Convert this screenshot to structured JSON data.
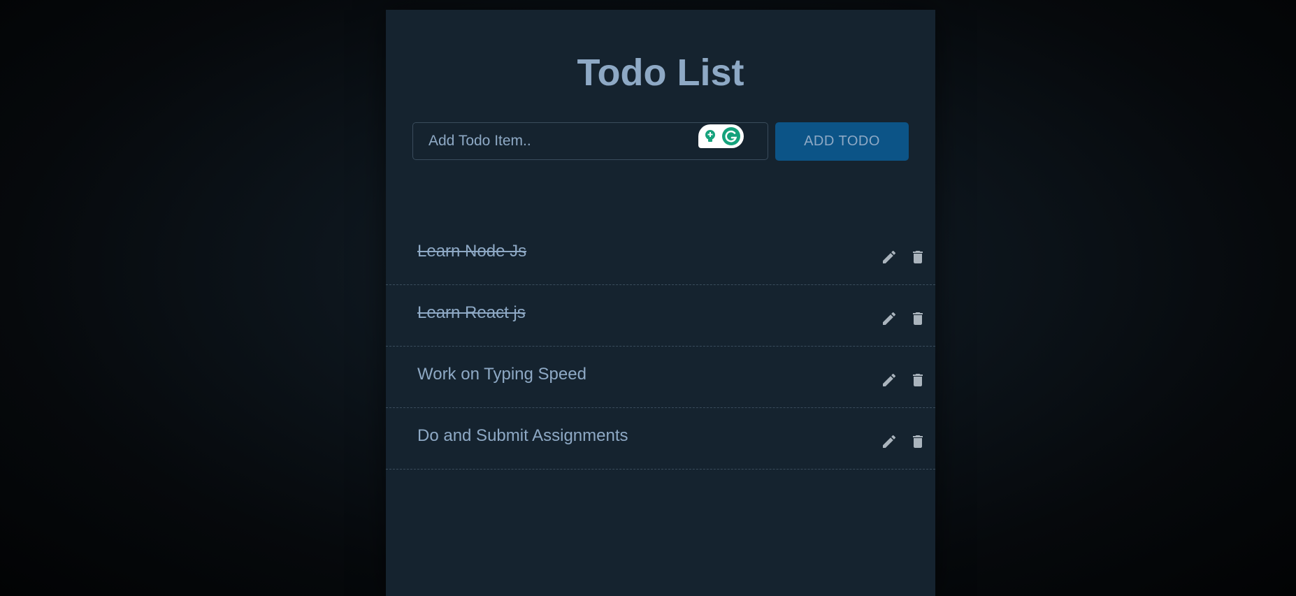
{
  "app": {
    "title": "Todo List"
  },
  "form": {
    "placeholder": "Add Todo Item..",
    "value": "",
    "add_label": "ADD TODO"
  },
  "grammarly": {
    "icons": [
      "lightbulb-icon",
      "grammarly-logo-icon"
    ],
    "accent": "#15a27c"
  },
  "todos": [
    {
      "text": "Learn Node Js",
      "completed": true
    },
    {
      "text": "Learn React js",
      "completed": true
    },
    {
      "text": "Work on Typing Speed",
      "completed": false
    },
    {
      "text": "Do and Submit Assignments",
      "completed": false
    }
  ],
  "icons": {
    "edit": "pencil-icon",
    "delete": "trash-icon"
  },
  "colors": {
    "panel": "#15232f",
    "text": "#8ea9c5",
    "button": "#0c5487",
    "icon": "#aab4bd"
  }
}
